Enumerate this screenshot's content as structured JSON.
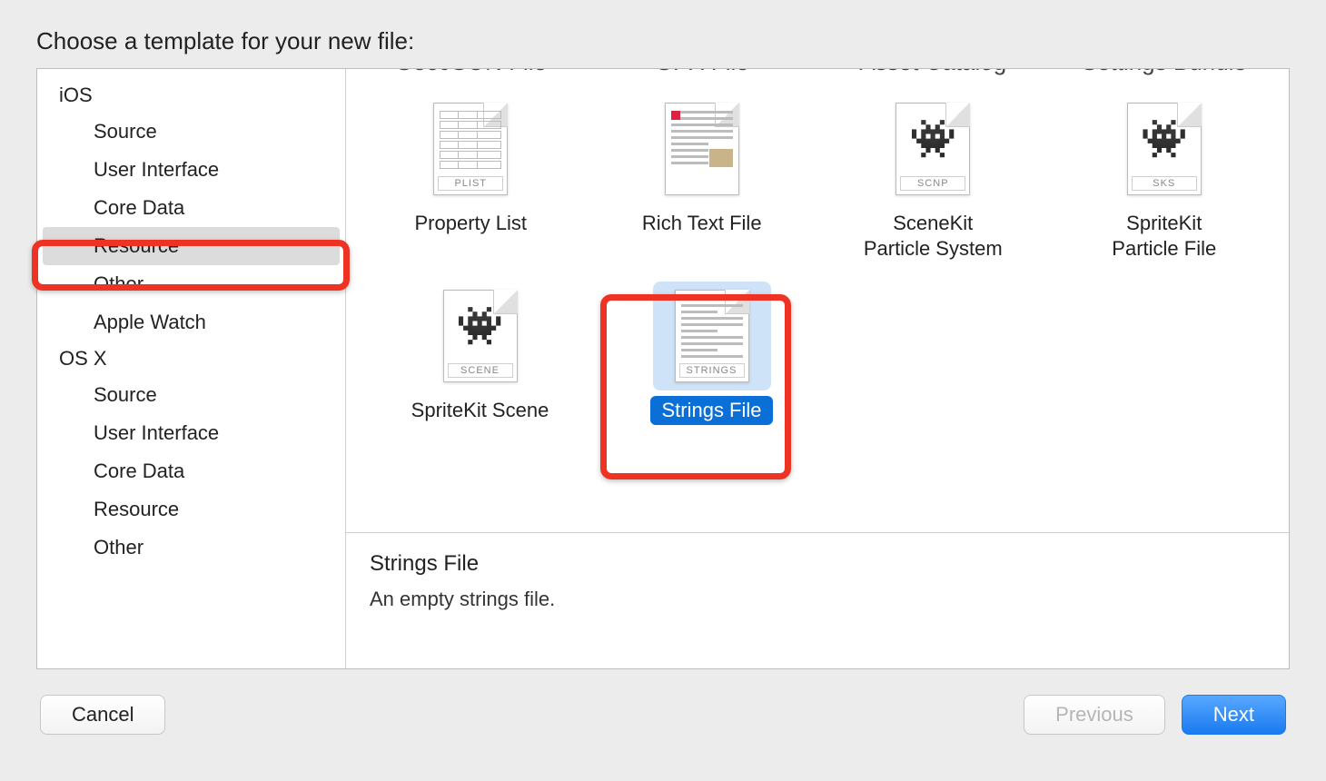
{
  "title": "Choose a template for your new file:",
  "sidebar": {
    "groups": [
      {
        "name": "iOS",
        "items": [
          "Source",
          "User Interface",
          "Core Data",
          "Resource",
          "Other",
          "Apple Watch"
        ],
        "selected": "Resource",
        "highlighted": "Resource"
      },
      {
        "name": "OS X",
        "items": [
          "Source",
          "User Interface",
          "Core Data",
          "Resource",
          "Other"
        ]
      }
    ]
  },
  "templates": {
    "cutoff_row": [
      "GeoJSON File",
      "GPX File",
      "Asset Catalog",
      "Settings Bundle"
    ],
    "rows": [
      [
        {
          "label": "Property List",
          "badge": "PLIST",
          "kind": "plist"
        },
        {
          "label": "Rich Text File",
          "badge": "",
          "kind": "richtext"
        },
        {
          "label": "SceneKit\nParticle System",
          "badge": "SCNP",
          "kind": "monster"
        },
        {
          "label": "SpriteKit\nParticle File",
          "badge": "SKS",
          "kind": "monster"
        }
      ],
      [
        {
          "label": "SpriteKit Scene",
          "badge": "SCENE",
          "kind": "monster"
        },
        {
          "label": "Strings File",
          "badge": "STRINGS",
          "kind": "textlines",
          "selected": true,
          "highlighted": true
        }
      ]
    ]
  },
  "details": {
    "name": "Strings File",
    "desc": "An empty strings file."
  },
  "buttons": {
    "cancel": "Cancel",
    "previous": "Previous",
    "next": "Next"
  }
}
